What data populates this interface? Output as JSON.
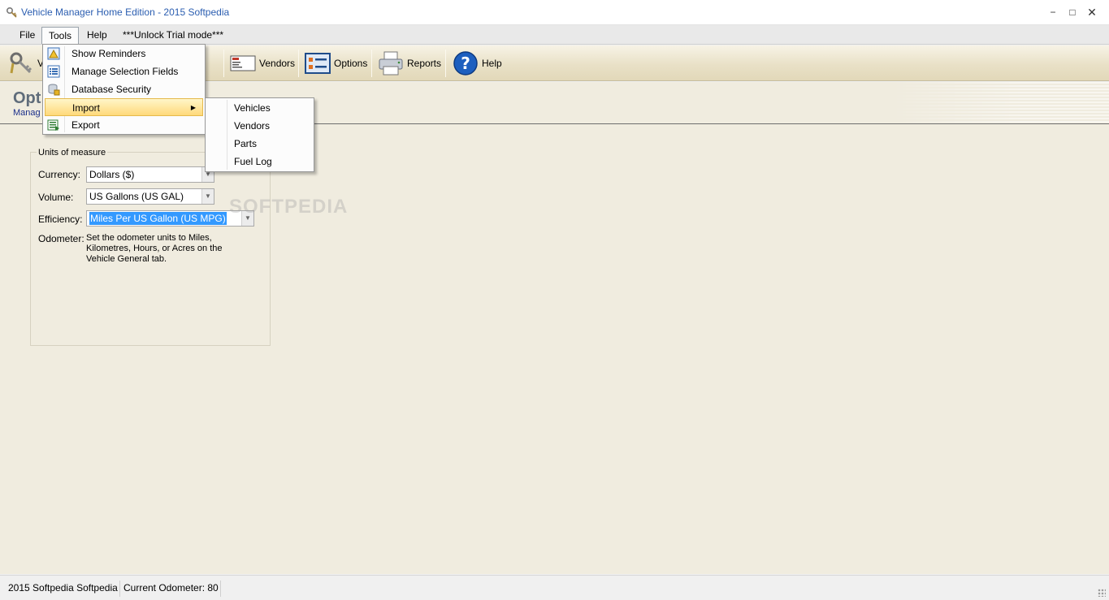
{
  "window": {
    "title": "Vehicle Manager Home Edition - 2015 Softpedia",
    "minimize": "−",
    "maximize": "□",
    "close": "✕"
  },
  "menubar": {
    "items": [
      "File",
      "Tools",
      "Help",
      "***Unlock Trial mode***"
    ],
    "open_item": "Tools"
  },
  "toolbar": {
    "first_label_visible": "V",
    "buttons": [
      {
        "label": "Vendors",
        "icon": "vendors-icon"
      },
      {
        "label": "Options",
        "icon": "options-icon"
      },
      {
        "label": "Reports",
        "icon": "printer-icon"
      },
      {
        "label": "Help",
        "icon": "help-icon"
      }
    ]
  },
  "tools_menu": {
    "items": [
      {
        "label": "Show Reminders",
        "icon": "reminders-icon"
      },
      {
        "label": "Manage Selection Fields",
        "icon": "list-icon"
      },
      {
        "label": "Database Security",
        "icon": "security-icon"
      },
      {
        "label": "Import",
        "icon": "",
        "has_submenu": true,
        "highlighted": true
      },
      {
        "label": "Export",
        "icon": "export-icon"
      }
    ],
    "submenu_arrow": "▶"
  },
  "import_submenu": {
    "items": [
      "Vehicles",
      "Vendors",
      "Parts",
      "Fuel Log"
    ]
  },
  "page": {
    "title_visible": "Opt",
    "subtitle_visible": "Manag",
    "watermark": "SOFTPEDIA"
  },
  "units": {
    "legend": "Units of measure",
    "currency_label": "Currency:",
    "currency_value": "Dollars ($)",
    "volume_label": "Volume:",
    "volume_value": "US Gallons (US GAL)",
    "efficiency_label": "Efficiency:",
    "efficiency_value": "Miles Per US Gallon (US MPG)",
    "odometer_label": "Odometer:",
    "odometer_note": "Set the odometer units to Miles, Kilometres, Hours, or Acres on the Vehicle General tab.",
    "combo_arrow": "▼"
  },
  "statusbar": {
    "left": "2015 Softpedia Softpedia",
    "odometer": "Current Odometer: 80"
  },
  "colors": {
    "title_text": "#2a5db0",
    "toolbar_bg": "#e9e1c7",
    "content_bg": "#f0ecdf",
    "menu_highlight": "#ffd97a",
    "selection": "#3399ff"
  }
}
